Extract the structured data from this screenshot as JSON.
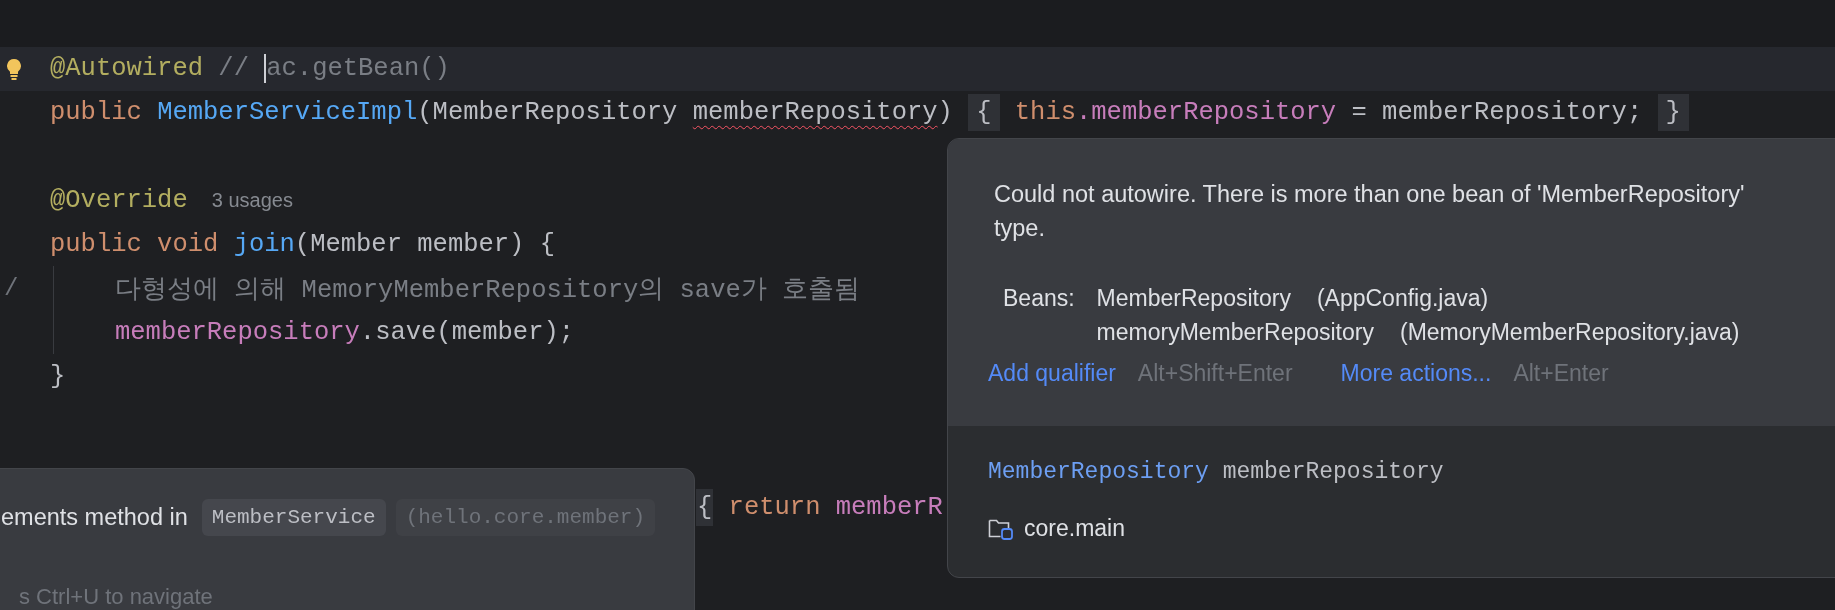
{
  "editor": {
    "lines": [
      {
        "kind": "member",
        "current": true,
        "lightbulb": true,
        "tokens": [
          {
            "text": "@Autowired ",
            "kind": "annotation"
          },
          {
            "text": "// ",
            "kind": "comment"
          },
          {
            "text": "ac.getBean()",
            "kind": "comment",
            "caret": true
          }
        ]
      },
      {
        "kind": "member",
        "current": false,
        "tokens": [
          {
            "text": "public ",
            "kind": "keyword"
          },
          {
            "text": "MemberServiceImpl",
            "kind": "method"
          },
          {
            "text": "(MemberRepository ",
            "kind": "plain"
          },
          {
            "text": "memberRepository",
            "kind": "plain",
            "error": true
          },
          {
            "text": ") ",
            "kind": "plain"
          },
          {
            "text": "{",
            "kind": "brace"
          },
          {
            "text": " this",
            "kind": "keyword"
          },
          {
            "text": ".memberRepository",
            "kind": "field"
          },
          {
            "text": " = memberRepository; ",
            "kind": "plain"
          },
          {
            "text": "}",
            "kind": "brace"
          }
        ]
      },
      {
        "kind": "member",
        "current": false
      },
      {
        "kind": "member",
        "current": false,
        "tokens": [
          {
            "text": "@Override",
            "kind": "annotation"
          }
        ],
        "hint": "3 usages"
      },
      {
        "kind": "member",
        "current": false,
        "tokens": [
          {
            "text": "public void ",
            "kind": "keyword"
          },
          {
            "text": "join",
            "kind": "method"
          },
          {
            "text": "(Member member) {",
            "kind": "plain"
          }
        ]
      },
      {
        "kind": "body",
        "current": false,
        "gutter_mark": "/",
        "tokens": [
          {
            "text": "다형성에 의해 MemoryMemberRepository의 save가 호출됨",
            "kind": "comment"
          }
        ]
      },
      {
        "kind": "body",
        "current": false,
        "tokens": [
          {
            "text": "memberRepository",
            "kind": "field"
          },
          {
            "text": ".save(member);",
            "kind": "plain"
          }
        ]
      },
      {
        "kind": "member",
        "current": false,
        "tokens": [
          {
            "text": "}",
            "kind": "plain"
          }
        ]
      },
      {
        "kind": "member",
        "current": false
      },
      {
        "kind": "member",
        "current": false
      },
      {
        "kind": "partial",
        "current": false,
        "tokens": [
          {
            "text": "{",
            "kind": "brace"
          },
          {
            "text": " return ",
            "kind": "keyword"
          },
          {
            "text": "memberR",
            "kind": "field"
          }
        ]
      }
    ]
  },
  "inspection_popup": {
    "message": "Could not autowire. There is more than one bean of 'MemberRepository' type.",
    "beans_label": "Beans:",
    "beans": [
      {
        "name": "MemberRepository",
        "source": "(AppConfig.java)"
      },
      {
        "name": "memoryMemberRepository",
        "source": "(MemoryMemberRepository.java)"
      }
    ],
    "actions": [
      {
        "label": "Add qualifier",
        "shortcut": "Alt+Shift+Enter"
      },
      {
        "label": "More actions...",
        "shortcut": "Alt+Enter"
      }
    ],
    "declaration": {
      "type": "MemberRepository",
      "name": "memberRepository"
    },
    "module": "core.main"
  },
  "implements_popup": {
    "text": "ements method in",
    "class_name": "MemberService",
    "package": "(hello.core.member)",
    "hint": "s Ctrl+U to navigate"
  }
}
